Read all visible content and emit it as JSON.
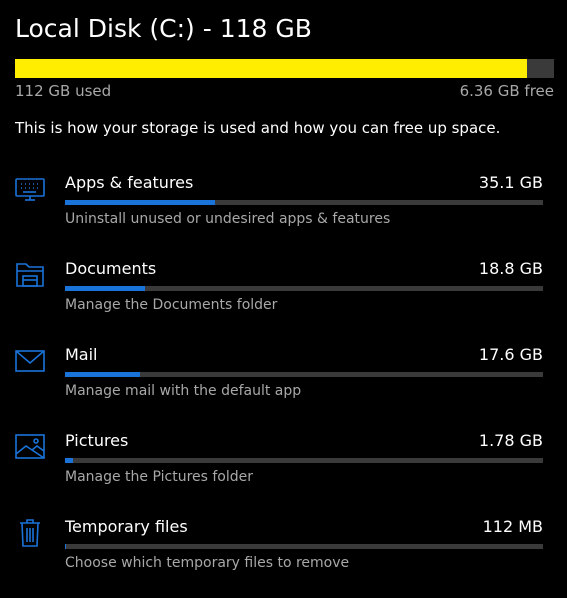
{
  "disk": {
    "title": "Local Disk (C:) - 118 GB",
    "used_label": "112 GB used",
    "free_label": "6.36 GB free",
    "used_fraction": 0.949,
    "bar_color": "#ffee00"
  },
  "description": "This is how your storage is used and how you can free up space.",
  "accent_color": "#1a73d9",
  "categories": [
    {
      "name": "Apps & features",
      "size": "35.1 GB",
      "subtitle": "Uninstall unused or undesired apps & features",
      "icon": "keyboard-icon",
      "fraction": 0.314
    },
    {
      "name": "Documents",
      "size": "18.8 GB",
      "subtitle": "Manage the Documents folder",
      "icon": "folder-icon",
      "fraction": 0.168
    },
    {
      "name": "Mail",
      "size": "17.6 GB",
      "subtitle": "Manage mail with the default app",
      "icon": "mail-icon",
      "fraction": 0.157
    },
    {
      "name": "Pictures",
      "size": "1.78 GB",
      "subtitle": "Manage the Pictures folder",
      "icon": "picture-icon",
      "fraction": 0.016
    },
    {
      "name": "Temporary files",
      "size": "112 MB",
      "subtitle": "Choose which temporary files to remove",
      "icon": "trash-icon",
      "fraction": 0.001
    }
  ]
}
